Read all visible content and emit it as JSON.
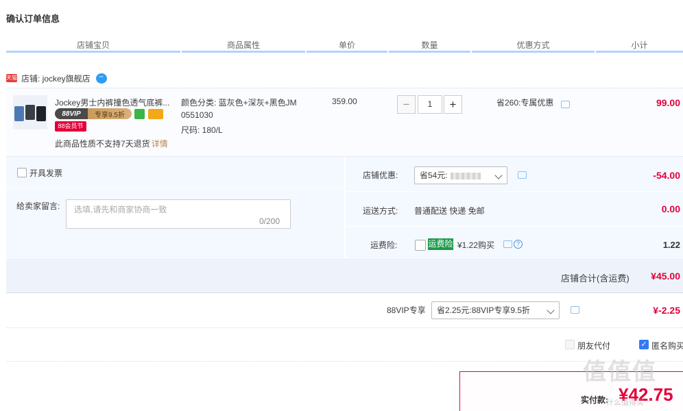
{
  "page": {
    "title": "确认订单信息"
  },
  "columns": [
    "店铺宝贝",
    "商品属性",
    "单价",
    "数量",
    "优惠方式",
    "小计"
  ],
  "shop": {
    "prefix_icon": "天猫",
    "label": "店铺: jockey旗舰店",
    "chat_icon_text": "\"\""
  },
  "item": {
    "title": "Jockey男士内裤撞色透气底裤...",
    "vip_badge_left": "88VIP",
    "vip_badge_right": "专享9.5折",
    "festival_badge": "88会员节",
    "return_note": "此商品性质不支持7天退货",
    "return_link": "详情",
    "attr_color": "颜色分类: 蓝灰色+深灰+黑色JM",
    "attr_code": "0551030",
    "attr_size": "尺码: 180/L",
    "unit_price": "359.00",
    "quantity": "1",
    "minus": "−",
    "plus": "+",
    "promo": "省260:专属优惠",
    "subtotal": "99.00"
  },
  "invoice": {
    "label": "开具发票"
  },
  "remark": {
    "label": "给卖家留言:",
    "placeholder": "选填,请先和商家协商一致",
    "counter": "0/200"
  },
  "shop_discount": {
    "label": "店铺优惠:",
    "value": "省54元:",
    "amount": "-54.00"
  },
  "shipping": {
    "label": "运送方式:",
    "value": "普通配送 快递 免邮",
    "amount": "0.00"
  },
  "insurance": {
    "label": "运费险:",
    "tag": "运费险",
    "desc": "¥1.22购买",
    "help": "?",
    "amount": "1.22"
  },
  "shop_total": {
    "label": "店铺合计(含运费)",
    "amount": "¥45.00"
  },
  "vip": {
    "label": "88VIP专享",
    "value": "省2.25元:88VIP专享9.5折",
    "amount": "¥-2.25"
  },
  "options": {
    "friend_pay": "朋友代付",
    "anonymous": "匿名购买",
    "check": "✓"
  },
  "payment": {
    "label": "实付款:",
    "amount": "¥42.75"
  },
  "watermark": {
    "main": "值值值",
    "sub": "什么值得买"
  },
  "colors": {
    "accent_red": "#e4003a",
    "header_line": "#b2d1ff",
    "panel_bg": "#f4f8ff"
  }
}
